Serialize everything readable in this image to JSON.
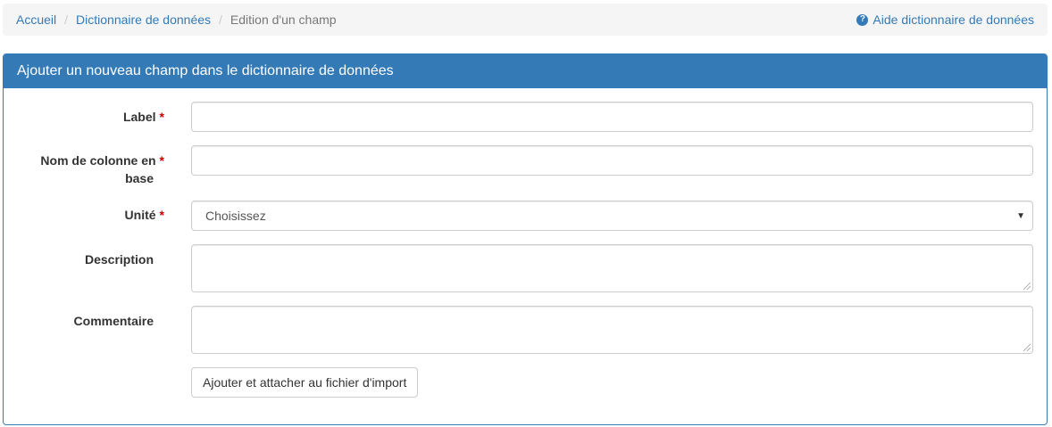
{
  "breadcrumb": {
    "home": "Accueil",
    "dictionary": "Dictionnaire de données",
    "current": "Edition d'un champ",
    "help_label": "Aide dictionnaire de données"
  },
  "panel": {
    "title": "Ajouter un nouveau champ dans le dictionnaire de données"
  },
  "form": {
    "label_label": "Label",
    "column_label_line1": "Nom de colonne en",
    "column_label_line2": "base",
    "unit_label": "Unité",
    "unit_selected": "Choisissez",
    "description_label": "Description",
    "comment_label": "Commentaire",
    "required_mark": "*",
    "submit_label": "Ajouter et attacher au fichier d'import"
  }
}
